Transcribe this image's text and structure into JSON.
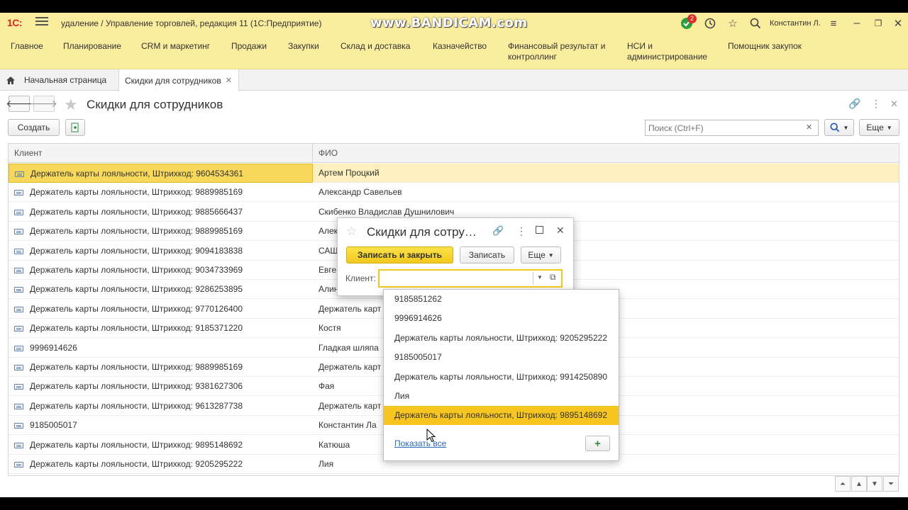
{
  "titlebar": {
    "logo": "1С:",
    "title": "удаление / Управление торговлей, редакция 11  (1С:Предприятие)",
    "watermark": "www.BANDICAM.com",
    "notifications_count": "2",
    "user": "Константин Л."
  },
  "menu": [
    {
      "label": "Главное"
    },
    {
      "label": "Планирование"
    },
    {
      "label": "CRM и маркетинг"
    },
    {
      "label": "Продажи"
    },
    {
      "label": "Закупки"
    },
    {
      "label": "Склад и доставка"
    },
    {
      "label": "Казначейство"
    },
    {
      "label": "Финансовый результат и\nконтроллинг"
    },
    {
      "label": "НСИ и\nадминистрирование"
    },
    {
      "label": "Помощник закупок"
    }
  ],
  "tabs": {
    "home": "Начальная страница",
    "active": "Скидки для сотрудников"
  },
  "form": {
    "title": "Скидки для сотрудников",
    "create": "Создать",
    "search_placeholder": "Поиск (Ctrl+F)",
    "more": "Еще"
  },
  "table": {
    "columns": [
      "Клиент",
      "ФИО"
    ],
    "rows": [
      {
        "client": "Держатель карты лояльности, Штрихкод: 9604534361",
        "fio": "Артем Процкий",
        "icon": true
      },
      {
        "client": "Держатель карты лояльности, Штрихкод: 9889985169",
        "fio": "Александр Савельев",
        "icon": true
      },
      {
        "client": "Держатель карты лояльности, Штрихкод: 9885666437",
        "fio": "Скибенко Владислав Душнилович",
        "icon": true
      },
      {
        "client": "Держатель карты лояльности, Штрихкод: 9889985169",
        "fio": "Алек",
        "icon": true
      },
      {
        "client": "Держатель карты лояльности, Штрихкод: 9094183838",
        "fio": "САШ",
        "icon": true
      },
      {
        "client": "Держатель карты лояльности, Штрихкод: 9034733969",
        "fio": "Евге",
        "icon": true
      },
      {
        "client": "Держатель карты лояльности, Штрихкод: 9286253895",
        "fio": "Алин",
        "icon": true
      },
      {
        "client": "Держатель карты лояльности, Штрихкод: 9770126400",
        "fio": "Держатель карт",
        "icon": true
      },
      {
        "client": "Держатель карты лояльности, Штрихкод: 9185371220",
        "fio": "Костя",
        "icon": true
      },
      {
        "client": "9996914626",
        "fio": "Гладкая шляпа",
        "icon": true
      },
      {
        "client": "Держатель карты лояльности, Штрихкод: 9889985169",
        "fio": "Держатель карт",
        "icon": true
      },
      {
        "client": "Держатель карты лояльности, Штрихкод: 9381627306",
        "fio": "Фая",
        "icon": true
      },
      {
        "client": "Держатель карты лояльности, Штрихкод: 9613287738",
        "fio": "Держатель карт",
        "icon": true
      },
      {
        "client": "9185005017",
        "fio": "Константин  Ла",
        "icon": true
      },
      {
        "client": "Держатель карты лояльности, Штрихкод: 9895148692",
        "fio": "Катюша",
        "icon": true
      },
      {
        "client": "Держатель карты лояльности, Штрихкод: 9205295222",
        "fio": "Лия",
        "icon": true
      }
    ]
  },
  "dialog": {
    "title": "Скидки для сотру…",
    "save_close": "Записать и закрыть",
    "save": "Записать",
    "more": "Еще",
    "client_label": "Клиент:",
    "client_value": ""
  },
  "dropdown": {
    "items": [
      "9185851262",
      "9996914626",
      "Держатель карты лояльности, Штрихкод: 9205295222",
      "9185005017",
      "Держатель карты лояльности, Штрихкод: 9914250890",
      "Лия",
      "Держатель карты лояльности, Штрихкод: 9895148692"
    ],
    "highlighted_index": 6,
    "show_all": "Показать все"
  }
}
